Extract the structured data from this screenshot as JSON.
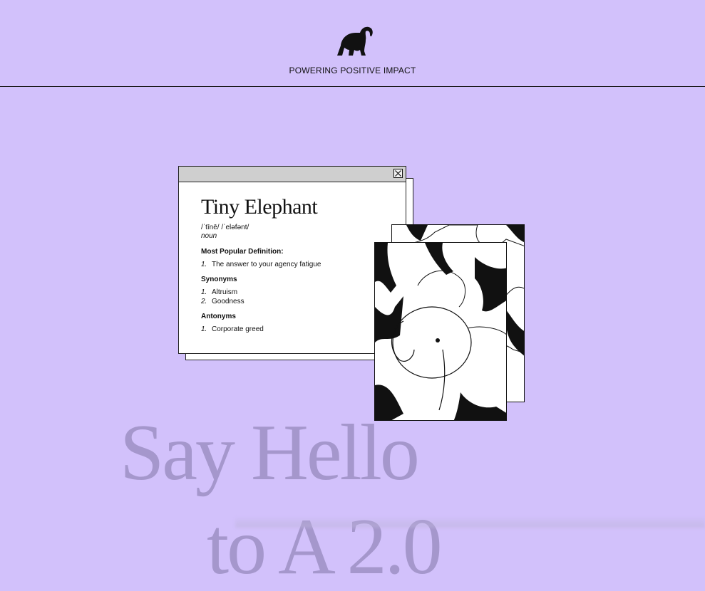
{
  "header": {
    "logo_icon": "elephant-icon",
    "tagline": "POWERING POSITIVE IMPACT"
  },
  "dictionary_window": {
    "close_icon": "close-icon",
    "title": "Tiny Elephant",
    "pronunciation": "/ˈtīnē/ /ˈeləfənt/",
    "part_of_speech": "noun",
    "definition": {
      "heading": "Most Popular Definition:",
      "items": [
        {
          "num": "1.",
          "text": "The answer to your agency fatigue"
        }
      ]
    },
    "synonyms": {
      "heading": "Synonyms",
      "items": [
        {
          "num": "1.",
          "text": "Altruism"
        },
        {
          "num": "2.",
          "text": "Goodness"
        }
      ]
    },
    "antonyms": {
      "heading": "Antonyms",
      "items": [
        {
          "num": "1.",
          "text": "Corporate greed"
        }
      ]
    }
  },
  "images": {
    "back_card": "elephant-pattern-illustration",
    "front_card": "elephant-pattern-illustration"
  },
  "hero": {
    "line1": "Say Hello",
    "line2": "to A         2.0"
  },
  "colors": {
    "background": "#d2c1fb",
    "hero_text": "#a597cc"
  }
}
